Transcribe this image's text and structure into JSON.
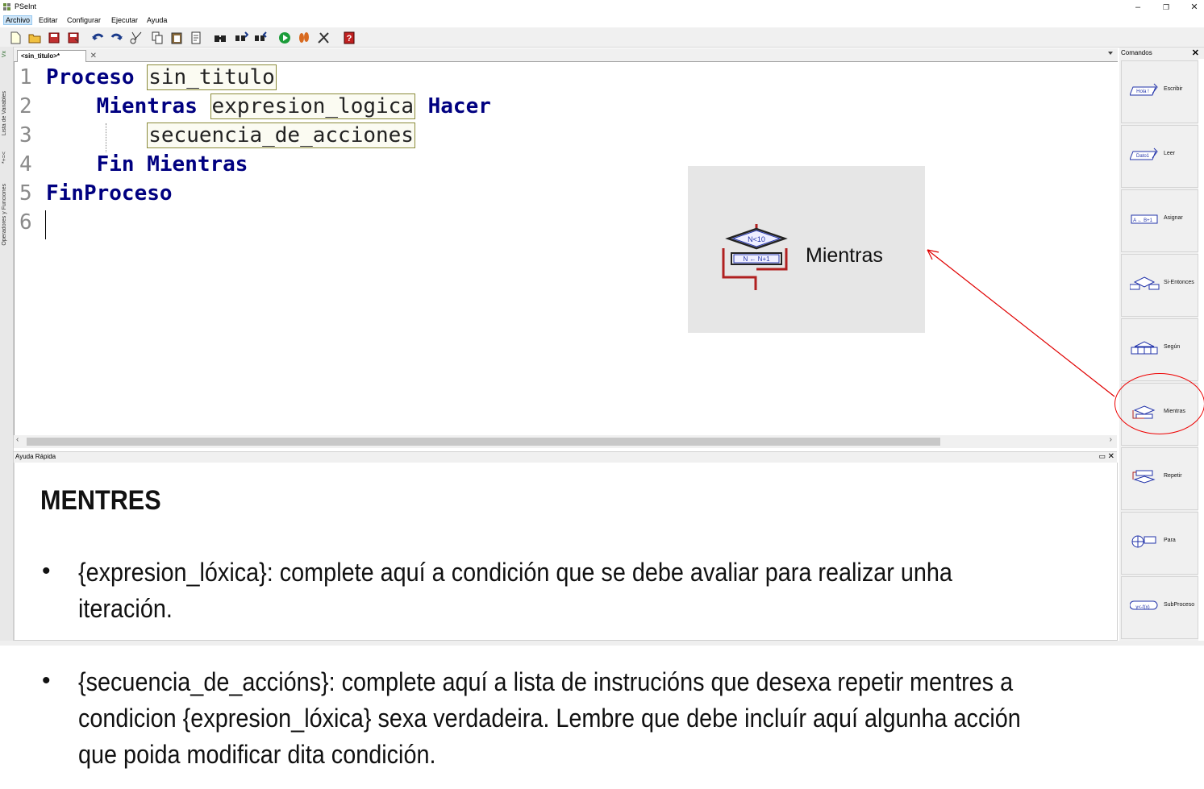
{
  "window": {
    "title": "PSeInt",
    "controls": {
      "minimize": "–",
      "restore": "❐",
      "close": "✕"
    }
  },
  "menu": {
    "items": [
      "Archivo",
      "Editar",
      "Configurar",
      "Ejecutar",
      "Ayuda"
    ]
  },
  "toolbar": {
    "icons": [
      "new-file-icon",
      "open-folder-icon",
      "save-icon",
      "save-as-icon",
      "undo-icon",
      "redo-icon",
      "cut-icon",
      "copy-icon",
      "paste-icon",
      "edit-icon",
      "find-icon",
      "find-previous-icon",
      "find-next-icon",
      "run-icon",
      "step-by-step-icon",
      "debug-icon",
      "help-icon"
    ]
  },
  "left_strip": {
    "labels": [
      "Lista de Variables",
      "Operadores y Funciones"
    ]
  },
  "editor": {
    "tab_label": "<sin_titulo>*",
    "lines": [
      {
        "n": "1",
        "tokens": [
          {
            "t": "Proceso",
            "kind": "kw"
          },
          {
            "t": " ",
            "kind": "sp"
          },
          {
            "t": "sin_titulo",
            "kind": "ph"
          }
        ]
      },
      {
        "n": "2",
        "tokens": [
          {
            "t": "    ",
            "kind": "sp"
          },
          {
            "t": "Mientras",
            "kind": "kw"
          },
          {
            "t": " ",
            "kind": "sp"
          },
          {
            "t": "expresion_logica",
            "kind": "ph"
          },
          {
            "t": " ",
            "kind": "sp"
          },
          {
            "t": "Hacer",
            "kind": "kw"
          }
        ]
      },
      {
        "n": "3",
        "tokens": [
          {
            "t": "        ",
            "kind": "sp"
          },
          {
            "t": "secuencia_de_acciones",
            "kind": "ph"
          }
        ]
      },
      {
        "n": "4",
        "tokens": [
          {
            "t": "    ",
            "kind": "sp"
          },
          {
            "t": "Fin Mientras",
            "kind": "kw"
          }
        ]
      },
      {
        "n": "5",
        "tokens": [
          {
            "t": "FinProceso",
            "kind": "kw"
          }
        ]
      },
      {
        "n": "6",
        "tokens": []
      }
    ]
  },
  "help_panel": {
    "header": "Ayuda Rápida",
    "title": "MENTRES",
    "bullet_1": "{expresion_lóxica}: complete aquí a condición que se debe avaliar para realizar unha",
    "bullet_1_cont": "iteración.",
    "bullet_2_l1": "{secuencia_de_accións}: complete aquí a lista de instrucións que desexa repetir mentres a",
    "bullet_2_l2": "condicion {expresion_lóxica} sexa verdadeira. Lembre que debe incluír aquí algunha acción",
    "bullet_2_l3": "que poida modificar dita condición.",
    "bullet_symbol": "•"
  },
  "zoom_popup": {
    "label": "Mientras",
    "icon_text_top": "N<10",
    "icon_text_bottom": "N ← N+1"
  },
  "commands": {
    "header": "Comandos",
    "close": "✕",
    "items": [
      {
        "label": "Escribir",
        "icon": "write-icon",
        "icon_text": "Hola !"
      },
      {
        "label": "Leer",
        "icon": "read-icon",
        "icon_text": "Dato1"
      },
      {
        "label": "Asignar",
        "icon": "assign-icon",
        "icon_text": "A ← B+1"
      },
      {
        "label": "Si-Entonces",
        "icon": "if-then-icon",
        "icon_text": ""
      },
      {
        "label": "Según",
        "icon": "switch-icon",
        "icon_text": ""
      },
      {
        "label": "Mientras",
        "icon": "while-icon",
        "icon_text": ""
      },
      {
        "label": "Repetir",
        "icon": "repeat-icon",
        "icon_text": ""
      },
      {
        "label": "Para",
        "icon": "for-icon",
        "icon_text": ""
      },
      {
        "label": "SubProceso",
        "icon": "subprocess-icon",
        "icon_text": "y<-f(x)"
      }
    ]
  },
  "colors": {
    "keyword": "#000080",
    "annotation": "#e00000"
  }
}
